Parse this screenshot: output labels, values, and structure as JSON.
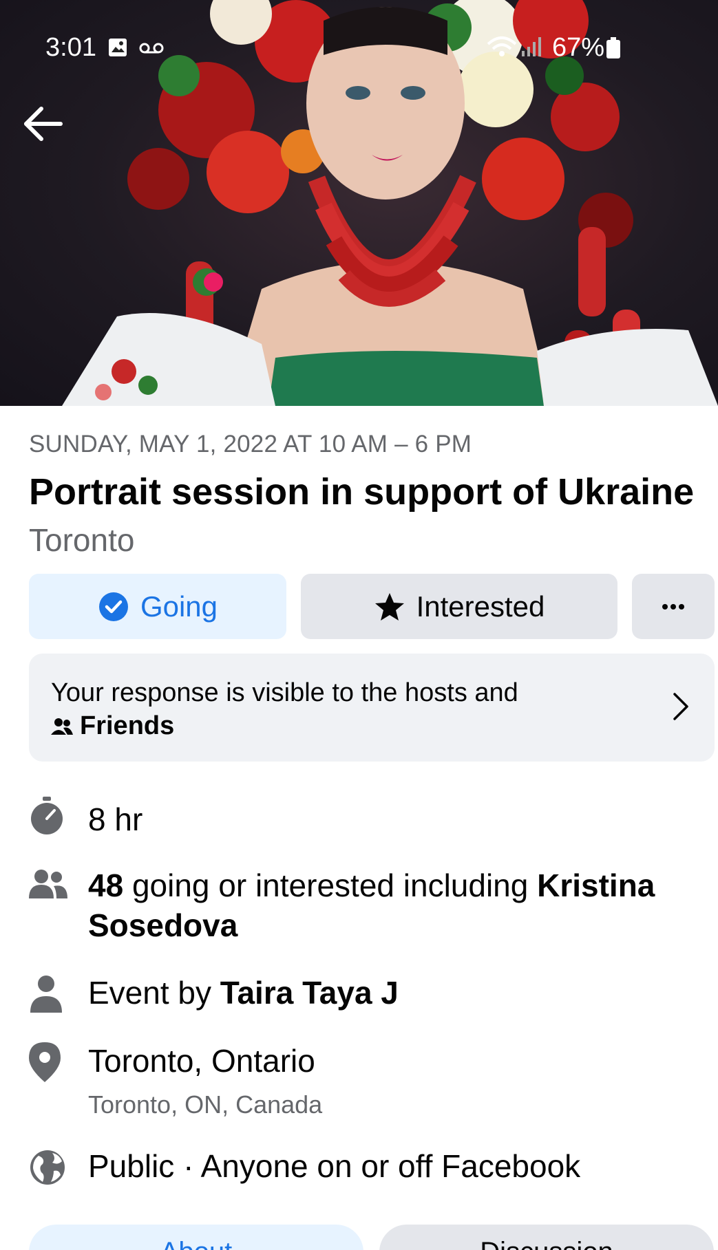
{
  "status_bar": {
    "time": "3:01",
    "battery": "67%",
    "icons": [
      "gallery-icon",
      "voicemail-icon",
      "wifi-icon",
      "signal-icon",
      "battery-icon"
    ]
  },
  "hero": {
    "back_icon": "arrow-left-icon"
  },
  "event": {
    "date": "SUNDAY, MAY 1, 2022 AT 10 AM – 6 PM",
    "title": "Portrait session in support of Ukraine",
    "city": "Toronto"
  },
  "actions": {
    "going_label": "Going",
    "interested_label": "Interested",
    "more_label": "···"
  },
  "response": {
    "text": "Your response is visible to the hosts and",
    "audience": "Friends"
  },
  "details": {
    "duration": "8 hr",
    "attendees_count": "48",
    "attendees_text": " going or interested including ",
    "attendees_name_1": "Kristina",
    "attendees_name_2": "Sosedova",
    "host_prefix": "Event by ",
    "host_name": "Taira Taya J",
    "location": "Toronto, Ontario",
    "location_sub": "Toronto, ON, Canada",
    "privacy": "Public · Anyone on or off Facebook"
  },
  "tabs": {
    "about": "About",
    "discussion": "Discussion"
  },
  "colors": {
    "accent": "#1b74e4",
    "accent_bg": "#e7f3ff",
    "secondary_text": "#65676b",
    "button_bg": "#e4e6eb"
  }
}
